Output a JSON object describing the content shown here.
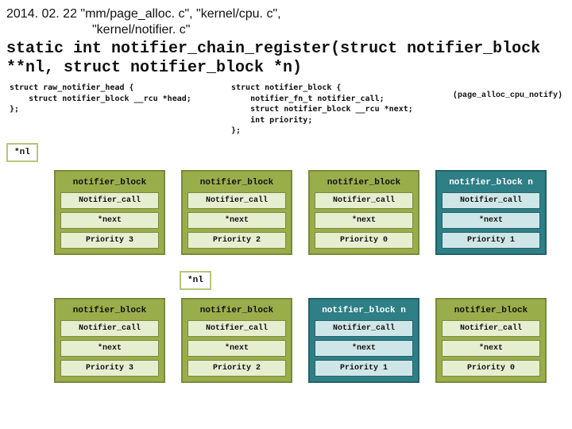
{
  "header": {
    "line1": "2014. 02. 22 \"mm/page_alloc. c\",  \"kernel/cpu. c\",",
    "line2": "\"kernel/notifier. c\""
  },
  "subtitle": "static int notifier_chain_register(struct notifier_block **nl, struct notifier_block *n)",
  "code": {
    "left": "struct raw_notifier_head {\n    struct notifier_block __rcu *head;\n};",
    "mid": "struct notifier_block {\n    notifier_fn_t notifier_call;\n    struct notifier_block __rcu *next;\n    int priority;\n};",
    "right": "(page_alloc_cpu_notify)"
  },
  "nl_label": "*nl",
  "cells": {
    "notifier_call": "Notifier_call",
    "next": "*next"
  },
  "row1": [
    {
      "kind": "olive",
      "title": "notifier_block",
      "priority": "Priority 3"
    },
    {
      "kind": "olive",
      "title": "notifier_block",
      "priority": "Priority 2"
    },
    {
      "kind": "olive",
      "title": "notifier_block",
      "priority": "Priority 0"
    },
    {
      "kind": "teal",
      "title": "notifier_block n",
      "priority": "Priority 1"
    }
  ],
  "row2": [
    {
      "kind": "olive",
      "title": "notifier_block",
      "priority": "Priority 3"
    },
    {
      "kind": "olive",
      "title": "notifier_block",
      "priority": "Priority 2"
    },
    {
      "kind": "teal",
      "title": "notifier_block n",
      "priority": "Priority 1"
    },
    {
      "kind": "olive",
      "title": "notifier_block",
      "priority": "Priority 0"
    }
  ]
}
